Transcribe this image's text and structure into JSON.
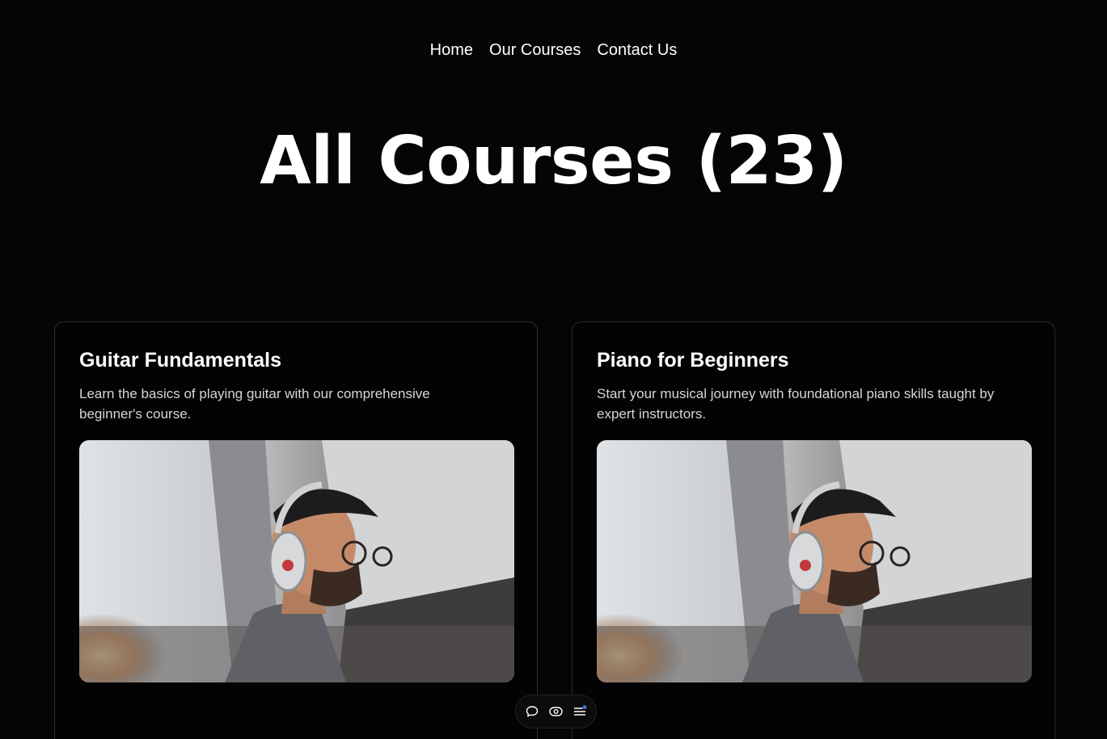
{
  "nav": {
    "items": [
      {
        "label": "Home"
      },
      {
        "label": "Our Courses"
      },
      {
        "label": "Contact Us"
      }
    ]
  },
  "page": {
    "title": "All Courses (23)"
  },
  "courses": [
    {
      "title": "Guitar Fundamentals",
      "description": "Learn the basics of playing guitar with our comprehensive beginner's course.",
      "image_icon": "photo-man-with-headphones"
    },
    {
      "title": "Piano for Beginners",
      "description": "Start your musical journey with foundational piano skills taught by expert instructors.",
      "image_icon": "photo-man-with-headphones"
    }
  ],
  "toolbar": {
    "icons": [
      "chat-bubble-icon",
      "eye-icon",
      "menu-lines-icon"
    ],
    "notification_color": "#3b82f6"
  },
  "colors": {
    "background": "#050505",
    "card_border": "#2b2b2b",
    "text_primary": "#ffffff",
    "text_secondary": "#d6d6d6"
  }
}
